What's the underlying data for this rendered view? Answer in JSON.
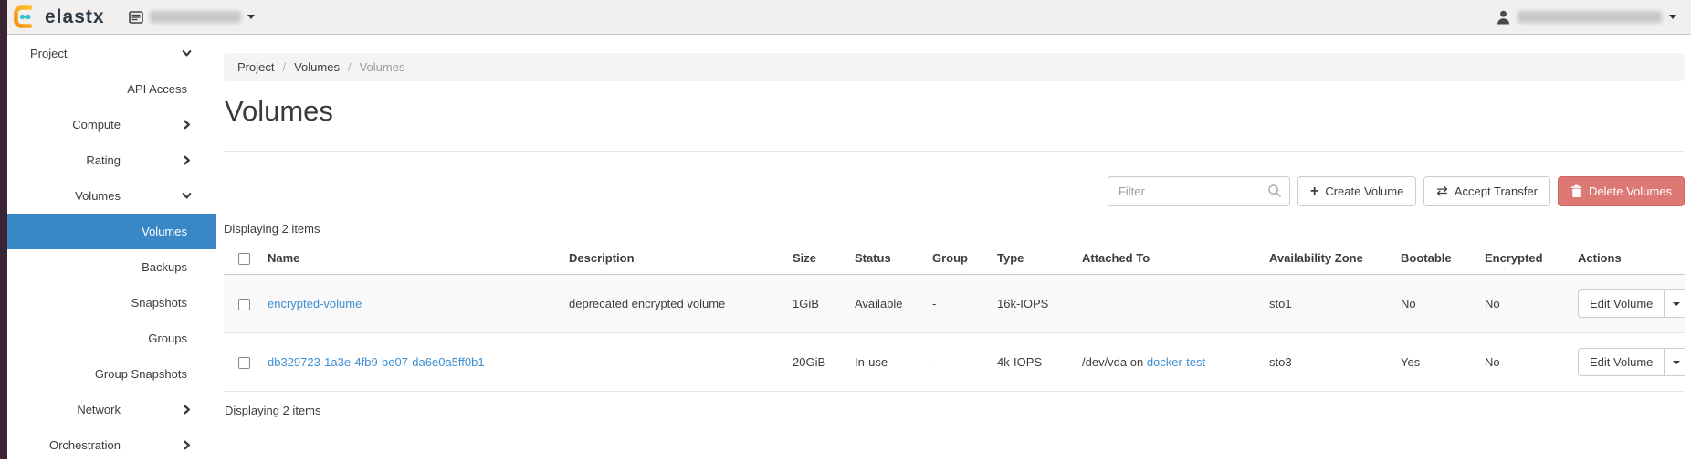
{
  "colors": {
    "accent_blue": "#3a87c8",
    "link_blue": "#3e8ed2",
    "danger_red": "#dc7975",
    "sidebar_strip": "#3a2433",
    "header_bg": "#f1f0ef"
  },
  "header": {
    "logo_text": "elastx"
  },
  "sidebar": {
    "items": [
      {
        "label": "Project"
      },
      {
        "label": "API Access"
      },
      {
        "label": "Compute"
      },
      {
        "label": "Rating"
      },
      {
        "label": "Volumes"
      },
      {
        "label": "Volumes"
      },
      {
        "label": "Backups"
      },
      {
        "label": "Snapshots"
      },
      {
        "label": "Groups"
      },
      {
        "label": "Group Snapshots"
      },
      {
        "label": "Network"
      },
      {
        "label": "Orchestration"
      }
    ]
  },
  "breadcrumb": {
    "items": [
      "Project",
      "Volumes",
      "Volumes"
    ],
    "separator": "/"
  },
  "page": {
    "title": "Volumes"
  },
  "toolbar": {
    "filter_placeholder": "Filter",
    "create_label": "Create Volume",
    "accept_label": "Accept Transfer",
    "delete_label": "Delete Volumes"
  },
  "table": {
    "caption_top": "Displaying 2 items",
    "caption_bottom": "Displaying 2 items",
    "headers": [
      "Name",
      "Description",
      "Size",
      "Status",
      "Group",
      "Type",
      "Attached To",
      "Availability Zone",
      "Bootable",
      "Encrypted",
      "Actions"
    ],
    "rows": [
      {
        "name": "encrypted-volume",
        "description": "deprecated encrypted volume",
        "size": "1GiB",
        "status": "Available",
        "group": "-",
        "type": "16k-IOPS",
        "attached_prefix": "",
        "attached_link": "",
        "availability_zone": "sto1",
        "bootable": "No",
        "encrypted": "No",
        "action": "Edit Volume"
      },
      {
        "name": "db329723-1a3e-4fb9-be07-da6e0a5ff0b1",
        "description": "-",
        "size": "20GiB",
        "status": "In-use",
        "group": "-",
        "type": "4k-IOPS",
        "attached_prefix": "/dev/vda on ",
        "attached_link": "docker-test",
        "availability_zone": "sto3",
        "bootable": "Yes",
        "encrypted": "No",
        "action": "Edit Volume"
      }
    ]
  }
}
